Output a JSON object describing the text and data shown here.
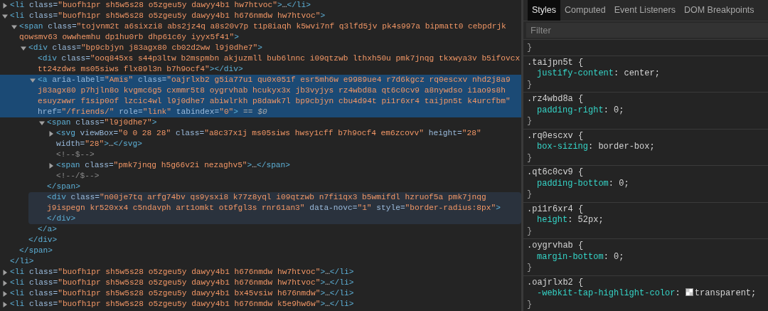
{
  "elements_panel": {
    "nodes": [
      {
        "kind": "element",
        "open": "<li class=\"buofh1pr sh5w5s28 o5zgeu5y dawyy4b1 hw7htvoc\">",
        "ellipsis": "…",
        "close": "</li>",
        "expanded": false,
        "selected": false,
        "hovered": false
      },
      {
        "kind": "element",
        "open": "<li class=\"buofh1pr sh5w5s28 o5zgeu5y dawyy4b1 h676nmdw hw7htvoc\">",
        "close": "</li>",
        "expanded": true,
        "selected": false,
        "hovered": false,
        "children": [
          {
            "kind": "element",
            "open": "<span class=\"tojvnm2t a6sixzi8 abs2jz4q a8s20v7p t1p8iaqh k5wvi7nf q3lfd5jv pk4s997a bipmatt0 cebpdrjk qowsmv63 owwhemhu dp1hu0rb dhp61c6y iyyx5f41\">",
            "close": "</span>",
            "expanded": true,
            "selected": false,
            "hovered": false,
            "children": [
              {
                "kind": "element",
                "open": "<div class=\"bp9cbjyn j83agx80 cb02d2ww l9j0dhe7\">",
                "close": "</div>",
                "expanded": true,
                "selected": false,
                "hovered": false,
                "children": [
                  {
                    "kind": "leaf",
                    "open": "<div class=\"ooq845xs s44p3ltw b2mspmbn akjuzmll bub6lnnc i09qtzwb lthxh50u pmk7jnqg tkxwya3v b5ifovcx tt24zdws ms05siws flx89l3n b7h9ocf4\">",
                    "close": "</div>",
                    "selected": false,
                    "hovered": false
                  },
                  {
                    "kind": "element",
                    "open": "<a aria-label=\"Amis\" class=\"oajrlxb2 g5ia77u1 qu0x051f esr5mh6w e9989ue4 r7d6kgcz rq0escxv nhd2j8a9 j83agx80 p7hjln8o kvgmc6g5 cxmmr5t8 oygrvhab hcukyx3x jb3vyjys rz4wbd8a qt6c0cv9 a8nywdso i1ao9s8h esuyzwwr f1sip0of lzcic4wl l9j0dhe7 abiwlrkh p8dawk7l bp9cbjyn cbu4d94t pi1r6xr4 taijpn5t k4urcfbm\" href=\"/friends/\" role=\"link\" tabindex=\"0\">",
                    "suffix": "== *$0*",
                    "close": "</a>",
                    "expanded": true,
                    "selected": true,
                    "hovered": false,
                    "children": [
                      {
                        "kind": "element",
                        "open": "<span class=\"l9j0dhe7\">",
                        "close": "</span>",
                        "expanded": true,
                        "selected": false,
                        "hovered": false,
                        "children": [
                          {
                            "kind": "element",
                            "open": "<svg viewBox=\"0 0 28 28\" class=\"a8c37x1j ms05siws hwsy1cff b7h9ocf4 em6zcovv\" height=\"28\" width=\"28\">",
                            "ellipsis": "…",
                            "close": "</svg>",
                            "expanded": false,
                            "selected": false,
                            "hovered": false
                          },
                          {
                            "kind": "comment",
                            "open": "<!--$-->",
                            "selected": false,
                            "hovered": false
                          },
                          {
                            "kind": "element",
                            "open": "<span class=\"pmk7jnqg h5g66v2i nezaghv5\">",
                            "ellipsis": "…",
                            "close": "</span>",
                            "expanded": false,
                            "selected": false,
                            "hovered": false
                          },
                          {
                            "kind": "comment",
                            "open": "<!--/$-->",
                            "selected": false,
                            "hovered": false
                          }
                        ]
                      },
                      {
                        "kind": "block",
                        "open": "<div class=\"n00je7tq arfg74bv qs9ysxi8 k77z8yql i09qtzwb n7fi1qx3 b5wmifdl hzruof5a pmk7jnqg j9ispegn kr520xx4 c5ndavph art1omkt ot9fgl3s rnr61an3\" data-novc=\"1\" style=\"border-radius:8px\">",
                        "close": "</div>",
                        "selected": false,
                        "hovered": true
                      }
                    ]
                  }
                ]
              }
            ]
          }
        ]
      },
      {
        "kind": "element",
        "open": "<li class=\"buofh1pr sh5w5s28 o5zgeu5y dawyy4b1 h676nmdw hw7htvoc\">",
        "ellipsis": "…",
        "close": "</li>",
        "expanded": false,
        "selected": false,
        "hovered": false
      },
      {
        "kind": "element",
        "open": "<li class=\"buofh1pr sh5w5s28 o5zgeu5y dawyy4b1 h676nmdw hw7htvoc\">",
        "ellipsis": "…",
        "close": "</li>",
        "expanded": false,
        "selected": false,
        "hovered": false
      },
      {
        "kind": "element",
        "open": "<li class=\"buofh1pr sh5w5s28 o5zgeu5y dawyy4b1 bx45vsiw h676nmdw\">",
        "ellipsis": "…",
        "close": "</li>",
        "expanded": false,
        "selected": false,
        "hovered": false
      },
      {
        "kind": "element",
        "open": "<li class=\"buofh1pr sh5w5s28 o5zgeu5y dawyy4b1 h676nmdw k5e9hw6w\">",
        "ellipsis": "…",
        "close": "</li>",
        "expanded": false,
        "selected": false,
        "hovered": false
      }
    ]
  },
  "styles_panel": {
    "tabs": [
      {
        "label": "Styles",
        "selected": true
      },
      {
        "label": "Computed",
        "selected": false
      },
      {
        "label": "Event Listeners",
        "selected": false
      },
      {
        "label": "DOM Breakpoints",
        "selected": false
      }
    ],
    "filter": {
      "placeholder": "Filter"
    },
    "rules": [
      {
        "close": "}"
      },
      {
        "selector": ".taijpn5t {",
        "declarations": [
          {
            "kind": "plain",
            "text": "justify-content: center;"
          }
        ],
        "close": "}"
      },
      {
        "selector": ".rz4wbd8a {",
        "declarations": [
          {
            "kind": "plain",
            "text": "padding-right: 0;"
          }
        ],
        "close": "}"
      },
      {
        "selector": ".rq0escxv {",
        "declarations": [
          {
            "kind": "plain",
            "text": "box-sizing: border-box;"
          }
        ],
        "close": "}"
      },
      {
        "selector": ".qt6c0cv9 {",
        "declarations": [
          {
            "kind": "plain",
            "text": "padding-bottom: 0;"
          }
        ],
        "close": "}"
      },
      {
        "selector": ".pi1r6xr4 {",
        "declarations": [
          {
            "kind": "plain",
            "text": "height: 52px;"
          }
        ],
        "close": "}"
      },
      {
        "selector": ".oygrvhab {",
        "declarations": [
          {
            "kind": "plain",
            "text": "margin-bottom: 0;"
          }
        ],
        "close": "}"
      },
      {
        "selector": ".oajrlxb2 {",
        "declarations": [
          {
            "kind": "color",
            "text": "-webkit-tap-highlight-color: transparent;"
          }
        ],
        "close": "}"
      }
    ]
  }
}
